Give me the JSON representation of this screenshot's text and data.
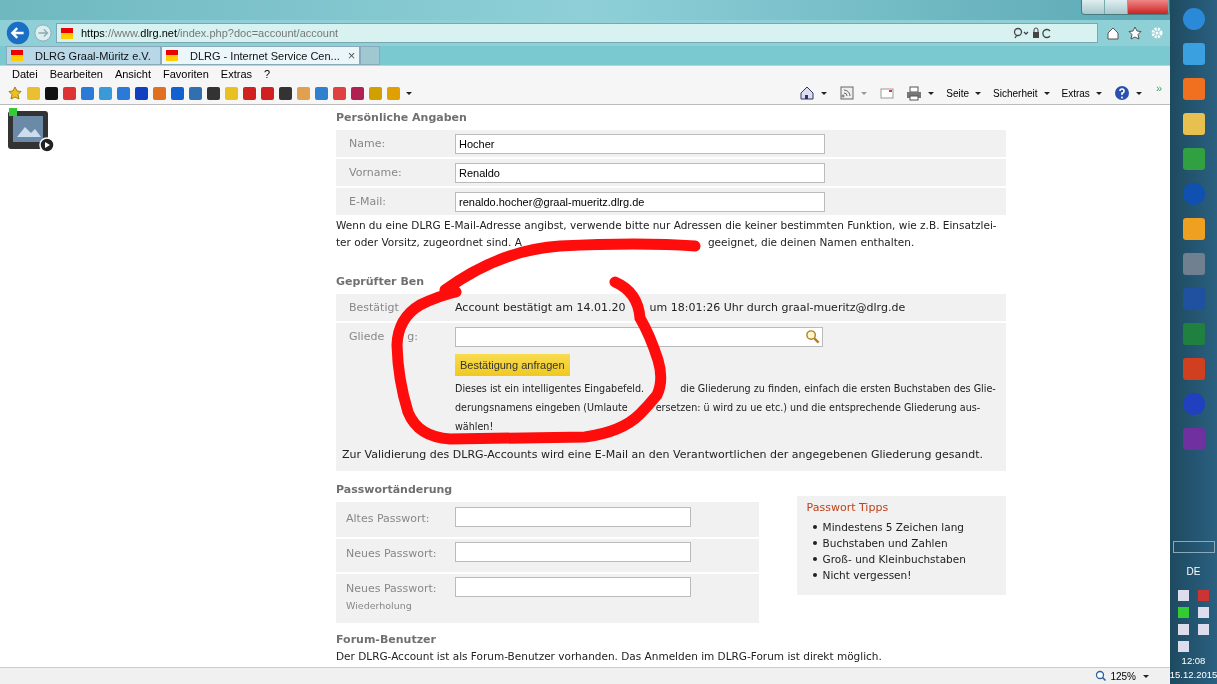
{
  "browser": {
    "address": "**https**://www.**dlrg.net**/index.php?doc=account/account",
    "tabs": [
      {
        "label": "DLRG Graal-Müritz e.V.",
        "selected": false,
        "closable": false
      },
      {
        "label": "DLRG - Internet Service Cen...",
        "selected": true,
        "closable": true
      }
    ],
    "close_glyph": "×",
    "menu": [
      "Datei",
      "Bearbeiten",
      "Ansicht",
      "Favoriten",
      "Extras",
      "?"
    ],
    "command_bar": [
      "Seite",
      "Sicherheit",
      "Extras"
    ],
    "more_glyph": "»",
    "zoom": "125%"
  },
  "personal": {
    "title": "Persönliche Angaben",
    "fields": [
      {
        "label": "Name:",
        "value": "Hocher"
      },
      {
        "label": "Vorname:",
        "value": "Renaldo"
      },
      {
        "label": "E-Mail:",
        "value": "renaldo.hocher@graal-mueritz.dlrg.de"
      }
    ],
    "note_lines": [
      [
        "Wenn du eine DLRG E-Mail-Adresse angibst, verwende bitte nur Adressen die keiner bestimmten Funktion, wie z.B. Einsatzlei-"
      ],
      [
        "ter oder Vorsitz, zugeordnet sind. A",
        "geeignet, die deinen Namen enthalten."
      ]
    ]
  },
  "verified": {
    "title": "Geprüfter Ben",
    "confirmed_label": "Bestätigt",
    "confirmed_parts": [
      "Account bestätigt am 14.01.20",
      "um 18:01:26 Uhr durch graal-mueritz@dlrg.de"
    ],
    "branch_label_parts": [
      "Gliede",
      "g:"
    ],
    "request_button": "Bestätigung anfragen",
    "help_lines": [
      [
        "Dieses ist ein intelligentes Eingabefeld.",
        "die Gliederung zu finden, einfach die ersten Buchstaben des Glie-"
      ],
      [
        "derungsnamens eingeben (Umlaute",
        "ersetzen: ü wird zu ue etc.) und die entsprechende Gliederung aus-"
      ],
      [
        "wählen!"
      ]
    ],
    "validation_note": "Zur Validierung des DLRG-Accounts wird eine E-Mail an den Verantwortlichen der angegebenen Gliederung gesandt."
  },
  "password": {
    "title": "Passwortänderung",
    "fields": [
      {
        "label": "Altes Passwort:"
      },
      {
        "label": "Neues Passwort:"
      },
      {
        "label": "Neues Passwort:",
        "sublabel": "Wiederholung"
      }
    ],
    "tips": {
      "title": "Passwort Tipps",
      "items": [
        "Mindestens 5 Zeichen lang",
        "Buchstaben und Zahlen",
        "Groß- und Kleinbuchstaben",
        "Nicht vergessen!"
      ]
    }
  },
  "forum": {
    "title": "Forum-Benutzer",
    "text": "Der DLRG-Account ist als Forum-Benutzer vorhanden. Das Anmelden im DLRG-Forum ist direkt möglich."
  },
  "taskbar": {
    "language": "DE",
    "time": "12:08",
    "date": "15.12.2015"
  }
}
